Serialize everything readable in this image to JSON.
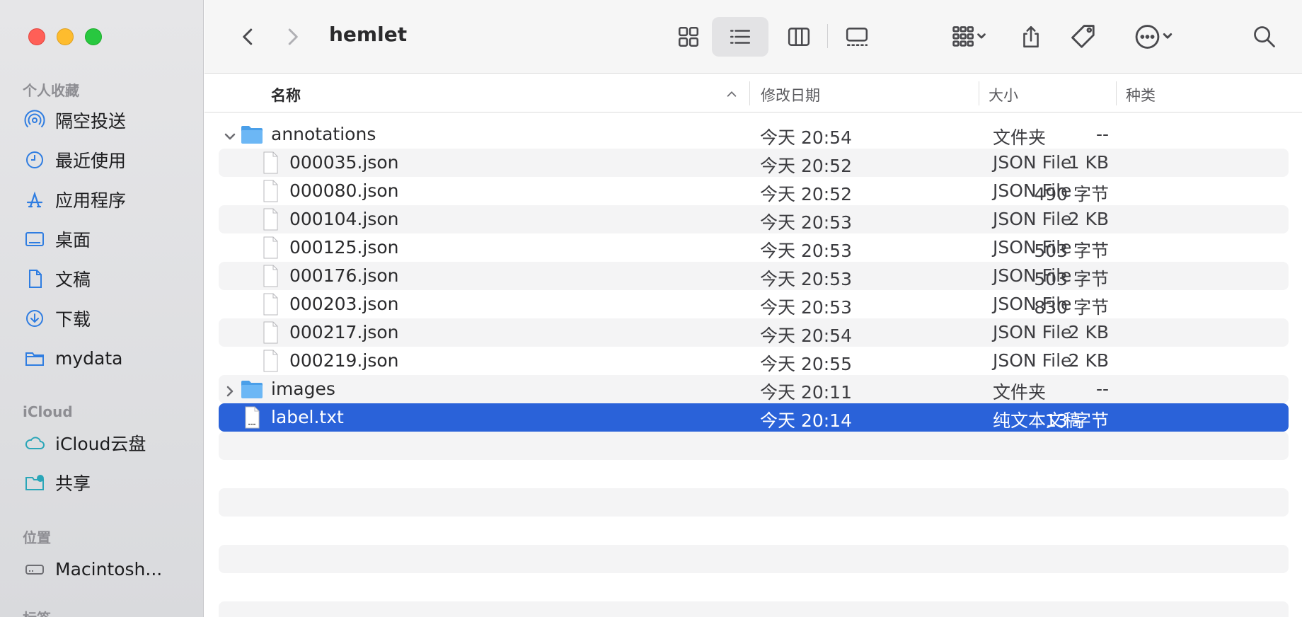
{
  "window": {
    "title": "hemlet"
  },
  "sidebar": {
    "sections": [
      {
        "heading": "个人收藏",
        "items": [
          {
            "label": "隔空投送",
            "icon": "airdrop-icon"
          },
          {
            "label": "最近使用",
            "icon": "clock-icon"
          },
          {
            "label": "应用程序",
            "icon": "applications-icon"
          },
          {
            "label": "桌面",
            "icon": "desktop-icon"
          },
          {
            "label": "文稿",
            "icon": "document-icon"
          },
          {
            "label": "下载",
            "icon": "download-icon"
          },
          {
            "label": "mydata",
            "icon": "folder-icon"
          }
        ]
      },
      {
        "heading": "iCloud",
        "items": [
          {
            "label": "iCloud云盘",
            "icon": "cloud-icon"
          },
          {
            "label": "共享",
            "icon": "shared-folder-icon"
          }
        ]
      },
      {
        "heading": "位置",
        "items": [
          {
            "label": "Macintosh...",
            "icon": "disk-icon"
          }
        ]
      },
      {
        "heading": "标签",
        "items": []
      }
    ]
  },
  "toolbar": {
    "back": "chevron-left-icon",
    "forward": "chevron-right-icon",
    "view_modes": [
      "icon-view-icon",
      "list-view-icon",
      "column-view-icon",
      "gallery-view-icon"
    ],
    "active_view": "list",
    "group": "group-icon",
    "share": "share-icon",
    "tag": "tag-icon",
    "more": "ellipsis-icon",
    "search": "search-icon"
  },
  "columns": {
    "name": "名称",
    "date": "修改日期",
    "size": "大小",
    "kind": "种类",
    "sort_indicator": "chevron-up-icon"
  },
  "rows": [
    {
      "name": "annotations",
      "date": "今天 20:54",
      "size": "--",
      "kind": "文件夹",
      "type": "folder",
      "expanded": true,
      "level": 0
    },
    {
      "name": "000035.json",
      "date": "今天 20:52",
      "size": "1 KB",
      "kind": "JSON File",
      "type": "file",
      "level": 1
    },
    {
      "name": "000080.json",
      "date": "今天 20:52",
      "size": "490 字节",
      "kind": "JSON File",
      "type": "file",
      "level": 1
    },
    {
      "name": "000104.json",
      "date": "今天 20:53",
      "size": "2 KB",
      "kind": "JSON File",
      "type": "file",
      "level": 1
    },
    {
      "name": "000125.json",
      "date": "今天 20:53",
      "size": "503 字节",
      "kind": "JSON File",
      "type": "file",
      "level": 1
    },
    {
      "name": "000176.json",
      "date": "今天 20:53",
      "size": "503 字节",
      "kind": "JSON File",
      "type": "file",
      "level": 1
    },
    {
      "name": "000203.json",
      "date": "今天 20:53",
      "size": "830 字节",
      "kind": "JSON File",
      "type": "file",
      "level": 1
    },
    {
      "name": "000217.json",
      "date": "今天 20:54",
      "size": "2 KB",
      "kind": "JSON File",
      "type": "file",
      "level": 1
    },
    {
      "name": "000219.json",
      "date": "今天 20:55",
      "size": "2 KB",
      "kind": "JSON File",
      "type": "file",
      "level": 1
    },
    {
      "name": "images",
      "date": "今天 20:11",
      "size": "--",
      "kind": "文件夹",
      "type": "folder",
      "expanded": false,
      "level": 0
    },
    {
      "name": "label.txt",
      "date": "今天 20:14",
      "size": "13 字节",
      "kind": "纯文本文稿",
      "type": "text",
      "level": 0,
      "selected": true
    }
  ],
  "colors": {
    "selection": "#2a62d9",
    "folder": "#5aa9f0",
    "sidebar_icon": "#2f7de1"
  }
}
